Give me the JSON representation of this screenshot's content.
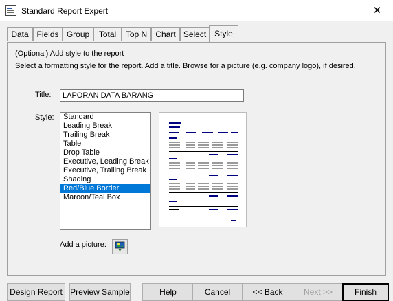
{
  "window": {
    "title": "Standard Report Expert",
    "close_glyph": "✕"
  },
  "tabs": [
    {
      "label": "Data"
    },
    {
      "label": "Fields"
    },
    {
      "label": "Group"
    },
    {
      "label": "Total"
    },
    {
      "label": "Top N"
    },
    {
      "label": "Chart"
    },
    {
      "label": "Select"
    },
    {
      "label": "Style"
    }
  ],
  "active_tab": "Style",
  "panel": {
    "line1": "(Optional) Add style to the report",
    "line2": "Select a formatting style for the report.  Add a title.  Browse for a picture (e.g. company logo), if desired.",
    "title_label": "Title:",
    "title_value": "LAPORAN DATA BARANG",
    "style_label": "Style:",
    "styles": [
      "Standard",
      "Leading Break",
      "Trailing Break",
      "Table",
      "Drop Table",
      "Executive, Leading Break",
      "Executive, Trailing Break",
      "Shading",
      "Red/Blue Border",
      "Maroon/Teal Box"
    ],
    "selected_style": "Red/Blue Border",
    "add_picture_label": "Add a picture:"
  },
  "buttons": {
    "design_report": "Design Report",
    "preview_sample": "Preview Sample",
    "help": "Help",
    "cancel": "Cancel",
    "back": "<< Back",
    "next": "Next >>",
    "finish": "Finish"
  },
  "colors": {
    "selection": "#0078d7",
    "preview_blue": "#000080",
    "preview_red": "#cc0000",
    "preview_gray": "#9a9a9a"
  }
}
